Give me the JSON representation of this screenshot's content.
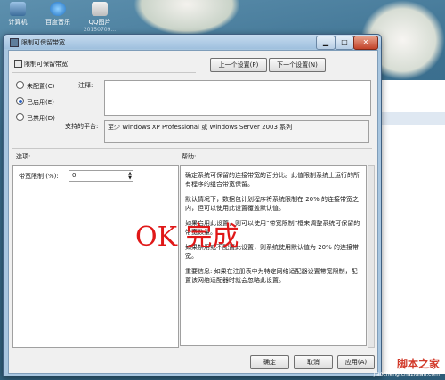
{
  "desktop": {
    "icons": [
      {
        "label": "计算机",
        "sub": ""
      },
      {
        "label": "百度音乐",
        "sub": ""
      },
      {
        "label": "QQ图片",
        "sub": "20150709..."
      }
    ]
  },
  "dialog": {
    "title": "限制可保留带宽",
    "heading": "限制可保留带宽",
    "prev_button": "上一个设置(P)",
    "next_button": "下一个设置(N)",
    "options": [
      {
        "label": "未配置(C)",
        "selected": false
      },
      {
        "label": "已启用(E)",
        "selected": true
      },
      {
        "label": "已禁用(D)",
        "selected": false
      }
    ],
    "comment_label": "注释:",
    "comment_value": "",
    "platform_label": "支持的平台:",
    "platform_value": "至少 Windows XP Professional 或 Windows Server 2003 系列",
    "options_label": "选项:",
    "help_label": "帮助:",
    "bandwidth_label": "带宽限制 (%):",
    "bandwidth_value": "0",
    "help_paragraphs": [
      "确定系统可保留的连接带宽的百分比。此值限制系统上运行的所有程序的组合带宽保留。",
      "默认情况下，数据包计划程序将系统限制在 20% 的连接带宽之内，但可以使用此设置覆盖默认值。",
      "如果启用此设置，则可以使用“带宽限制”框来调整系统可保留的带宽数量。",
      "如果禁用或不配置此设置，则系统使用默认值为 20% 的连接带宽。",
      "重要信息: 如果在注册表中为特定网络适配器设置带宽限制，配置该网络适配器时就会忽略此设置。"
    ],
    "ok_button": "确定",
    "cancel_button": "取消",
    "apply_button": "应用(A)"
  },
  "annotation": {
    "text": "OK 完成"
  },
  "watermark": {
    "line1": "脚本之家",
    "line2": "jiaocheng.chazidian.com"
  },
  "colors": {
    "annotation": "#e01818",
    "selected_radio": "#2a63c8",
    "titlebar": "#a8c6e0"
  }
}
